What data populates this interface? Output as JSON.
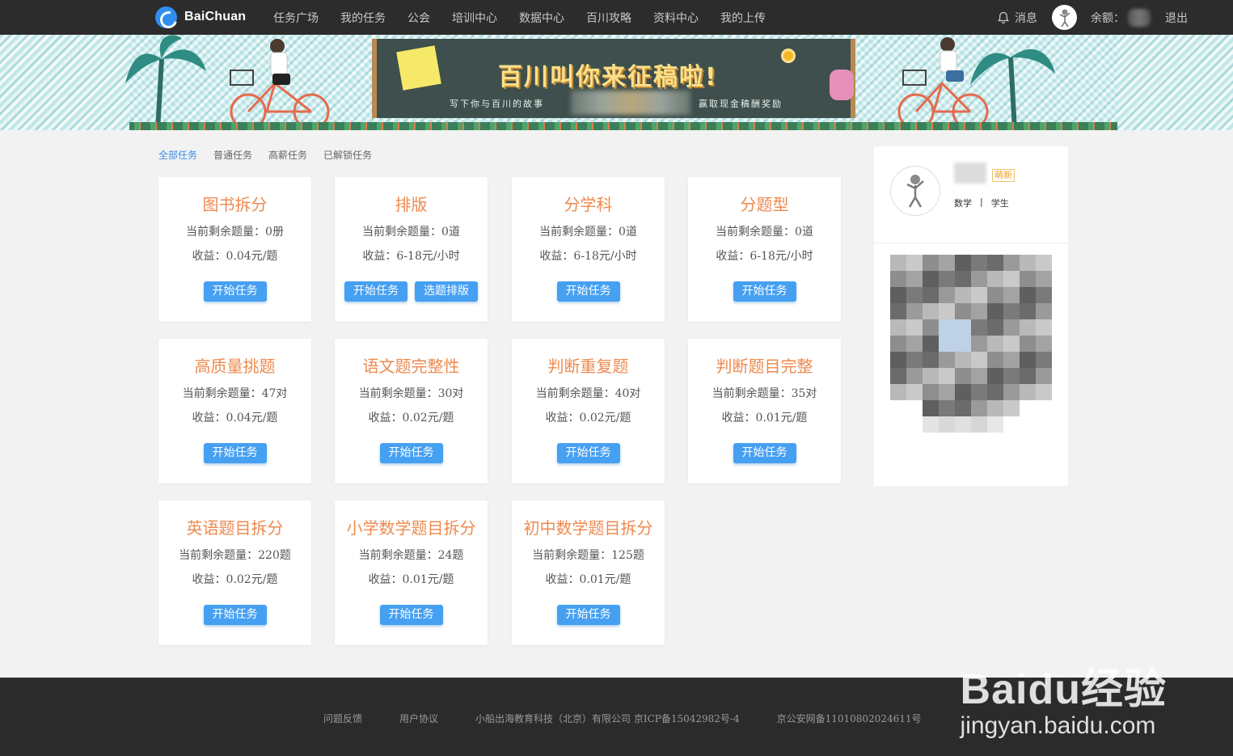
{
  "header": {
    "logo_text": "BaiChuan",
    "nav": [
      "任务广场",
      "我的任务",
      "公会",
      "培训中心",
      "数据中心",
      "百川攻略",
      "资料中心",
      "我的上传"
    ],
    "message_label": "消息",
    "balance_label": "余额：",
    "logout_label": "退出"
  },
  "banner": {
    "title": "百川叫你来征稿啦!",
    "subtitle_left": "写下你与百川的故事",
    "subtitle_right": "赢取现金稿酬奖励"
  },
  "tabs": [
    "全部任务",
    "普通任务",
    "高薪任务",
    "已解锁任务"
  ],
  "tasks": [
    {
      "title": "图书拆分",
      "remaining": "当前剩余题量：0册",
      "income": "收益：0.04元/题",
      "buttons": [
        "开始任务"
      ]
    },
    {
      "title": "排版",
      "remaining": "当前剩余题量：0道",
      "income": "收益：6-18元/小时",
      "buttons": [
        "开始任务",
        "选题排版"
      ]
    },
    {
      "title": "分学科",
      "remaining": "当前剩余题量：0道",
      "income": "收益：6-18元/小时",
      "buttons": [
        "开始任务"
      ]
    },
    {
      "title": "分题型",
      "remaining": "当前剩余题量：0道",
      "income": "收益：6-18元/小时",
      "buttons": [
        "开始任务"
      ]
    },
    {
      "title": "高质量挑题",
      "remaining": "当前剩余题量：47对",
      "income": "收益：0.04元/题",
      "buttons": [
        "开始任务"
      ]
    },
    {
      "title": "语文题完整性",
      "remaining": "当前剩余题量：30对",
      "income": "收益：0.02元/题",
      "buttons": [
        "开始任务"
      ]
    },
    {
      "title": "判断重复题",
      "remaining": "当前剩余题量：40对",
      "income": "收益：0.02元/题",
      "buttons": [
        "开始任务"
      ]
    },
    {
      "title": "判断题目完整",
      "remaining": "当前剩余题量：35对",
      "income": "收益：0.01元/题",
      "buttons": [
        "开始任务"
      ]
    },
    {
      "title": "英语题目拆分",
      "remaining": "当前剩余题量：220题",
      "income": "收益：0.02元/题",
      "buttons": [
        "开始任务"
      ]
    },
    {
      "title": "小学数学题目拆分",
      "remaining": "当前剩余题量：24题",
      "income": "收益：0.01元/题",
      "buttons": [
        "开始任务"
      ]
    },
    {
      "title": "初中数学题目拆分",
      "remaining": "当前剩余题量：125题",
      "income": "收益：0.01元/题",
      "buttons": [
        "开始任务"
      ]
    }
  ],
  "profile": {
    "badge": "萌新",
    "subject": "数学",
    "separator": "|",
    "role": "学生"
  },
  "footer": {
    "links": [
      "问题反馈",
      "用户协议",
      "小船出海教育科技（北京）有限公司 京ICP备15042982号-4",
      "京公安网备11010802024611号"
    ]
  },
  "watermark": {
    "brand": "Baidu经验",
    "domain": "jingyan.baidu.com"
  }
}
